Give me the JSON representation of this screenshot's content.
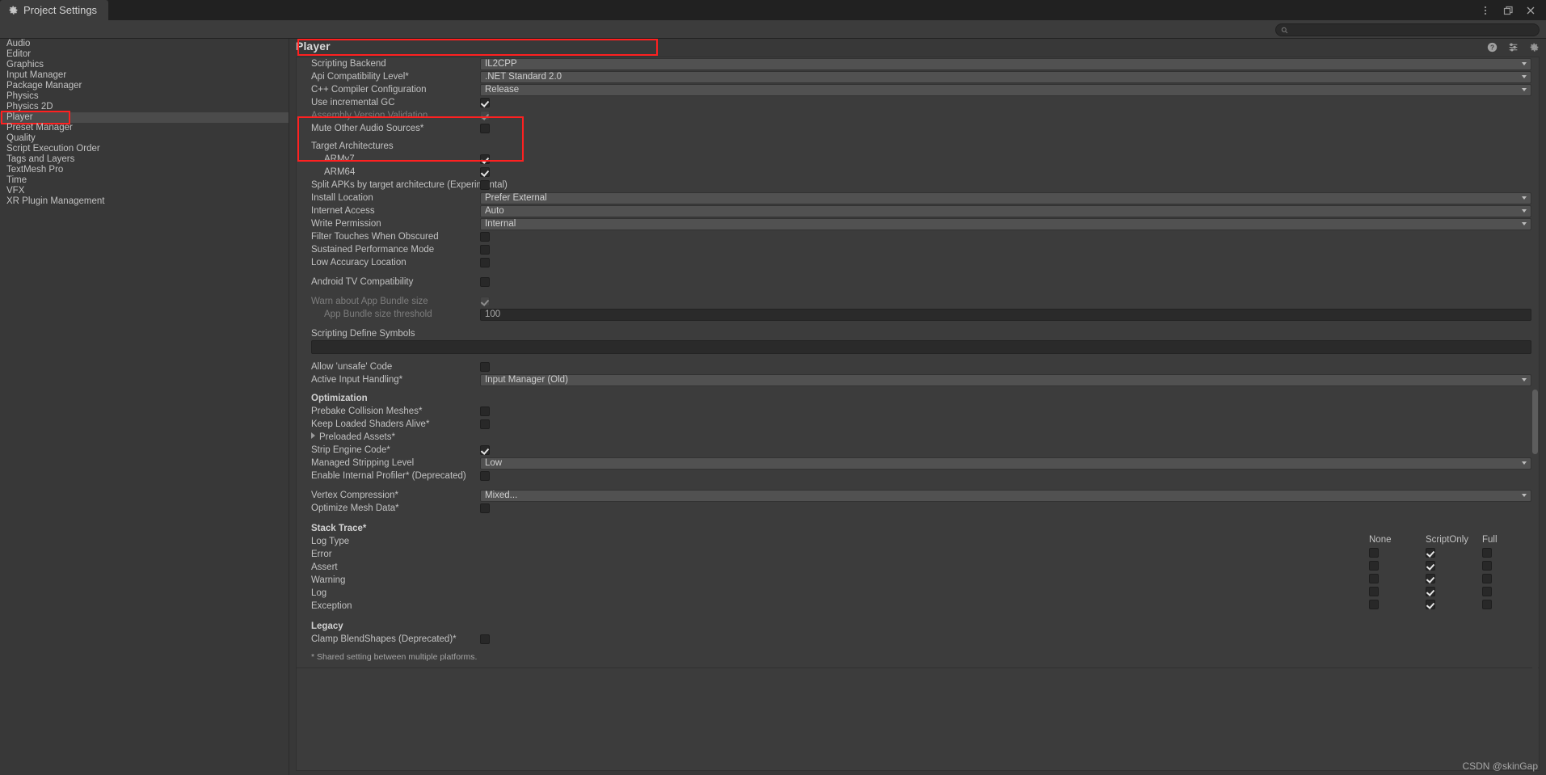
{
  "window": {
    "tab_label": "Project Settings",
    "gear_icon": "gear-icon",
    "menu_icon": "kebab-menu-icon",
    "maximize_icon": "maximize-icon",
    "close_icon": "close-icon"
  },
  "search": {
    "value": "",
    "placeholder": "",
    "icon": "search-icon"
  },
  "sidebar": {
    "items": [
      {
        "label": "Audio",
        "selected": false
      },
      {
        "label": "Editor",
        "selected": false
      },
      {
        "label": "Graphics",
        "selected": false
      },
      {
        "label": "Input Manager",
        "selected": false
      },
      {
        "label": "Package Manager",
        "selected": false
      },
      {
        "label": "Physics",
        "selected": false
      },
      {
        "label": "Physics 2D",
        "selected": false
      },
      {
        "label": "Player",
        "selected": true
      },
      {
        "label": "Preset Manager",
        "selected": false
      },
      {
        "label": "Quality",
        "selected": false
      },
      {
        "label": "Script Execution Order",
        "selected": false
      },
      {
        "label": "Tags and Layers",
        "selected": false
      },
      {
        "label": "TextMesh Pro",
        "selected": false
      },
      {
        "label": "Time",
        "selected": false
      },
      {
        "label": "VFX",
        "selected": false
      },
      {
        "label": "XR Plugin Management",
        "selected": false
      }
    ]
  },
  "main": {
    "title": "Player",
    "header_icons": [
      "help-icon",
      "preset-icon",
      "settings-gear-icon"
    ],
    "rows": {
      "scripting_backend": {
        "label": "Scripting Backend",
        "value": "IL2CPP"
      },
      "api_compat": {
        "label": "Api Compatibility Level*",
        "value": ".NET Standard 2.0"
      },
      "cpp_compiler": {
        "label": "C++ Compiler Configuration",
        "value": "Release"
      },
      "incremental_gc": {
        "label": "Use incremental GC",
        "checked": true
      },
      "assembly_version": {
        "label": "Assembly Version Validation",
        "checked": true
      },
      "mute_audio": {
        "label": "Mute Other Audio Sources*",
        "checked": false
      },
      "target_arch_header": {
        "label": "Target Architectures"
      },
      "armv7": {
        "label": "ARMv7",
        "checked": true
      },
      "arm64": {
        "label": "ARM64",
        "checked": true
      },
      "split_apks": {
        "label": "Split APKs by target architecture (Experimental)",
        "checked": false
      },
      "install_location": {
        "label": "Install Location",
        "value": "Prefer External"
      },
      "internet_access": {
        "label": "Internet Access",
        "value": "Auto"
      },
      "write_permission": {
        "label": "Write Permission",
        "value": "Internal"
      },
      "filter_touches": {
        "label": "Filter Touches When Obscured",
        "checked": false
      },
      "sustained_perf": {
        "label": "Sustained Performance Mode",
        "checked": false
      },
      "low_accuracy": {
        "label": "Low Accuracy Location",
        "checked": false
      },
      "android_tv": {
        "label": "Android TV Compatibility",
        "checked": false
      },
      "warn_bundle": {
        "label": "Warn about App Bundle size",
        "checked": true
      },
      "bundle_threshold": {
        "label": "App Bundle size threshold",
        "value": "100"
      },
      "define_symbols": {
        "label": "Scripting Define Symbols",
        "value": ""
      },
      "allow_unsafe": {
        "label": "Allow 'unsafe' Code",
        "checked": false
      },
      "active_input": {
        "label": "Active Input Handling*",
        "value": "Input Manager (Old)"
      },
      "optimization_header": {
        "label": "Optimization"
      },
      "prebake_collision": {
        "label": "Prebake Collision Meshes*",
        "checked": false
      },
      "keep_shaders": {
        "label": "Keep Loaded Shaders Alive*",
        "checked": false
      },
      "preloaded_assets": {
        "label": "Preloaded Assets*"
      },
      "strip_engine": {
        "label": "Strip Engine Code*",
        "checked": true
      },
      "managed_stripping": {
        "label": "Managed Stripping Level",
        "value": "Low"
      },
      "internal_profiler": {
        "label": "Enable Internal Profiler* (Deprecated)",
        "checked": false
      },
      "vertex_compression": {
        "label": "Vertex Compression*",
        "value": "Mixed..."
      },
      "optimize_mesh": {
        "label": "Optimize Mesh Data*",
        "checked": false
      },
      "stack_trace_header": {
        "label": "Stack Trace*"
      },
      "log_type_label": {
        "label": "Log Type"
      },
      "legacy_header": {
        "label": "Legacy"
      },
      "clamp_blendshapes": {
        "label": "Clamp BlendShapes (Deprecated)*",
        "checked": false
      }
    },
    "stack_trace": {
      "columns": [
        "None",
        "ScriptOnly",
        "Full"
      ],
      "rows": [
        {
          "label": "Error",
          "selected": "ScriptOnly"
        },
        {
          "label": "Assert",
          "selected": "ScriptOnly"
        },
        {
          "label": "Warning",
          "selected": "ScriptOnly"
        },
        {
          "label": "Log",
          "selected": "ScriptOnly"
        },
        {
          "label": "Exception",
          "selected": "ScriptOnly"
        }
      ]
    },
    "footnote": "* Shared setting between multiple platforms."
  },
  "watermark": "CSDN @skinGap",
  "colors": {
    "annotation": "#ff2020",
    "panel": "#3c3c3c",
    "background": "#383838"
  }
}
